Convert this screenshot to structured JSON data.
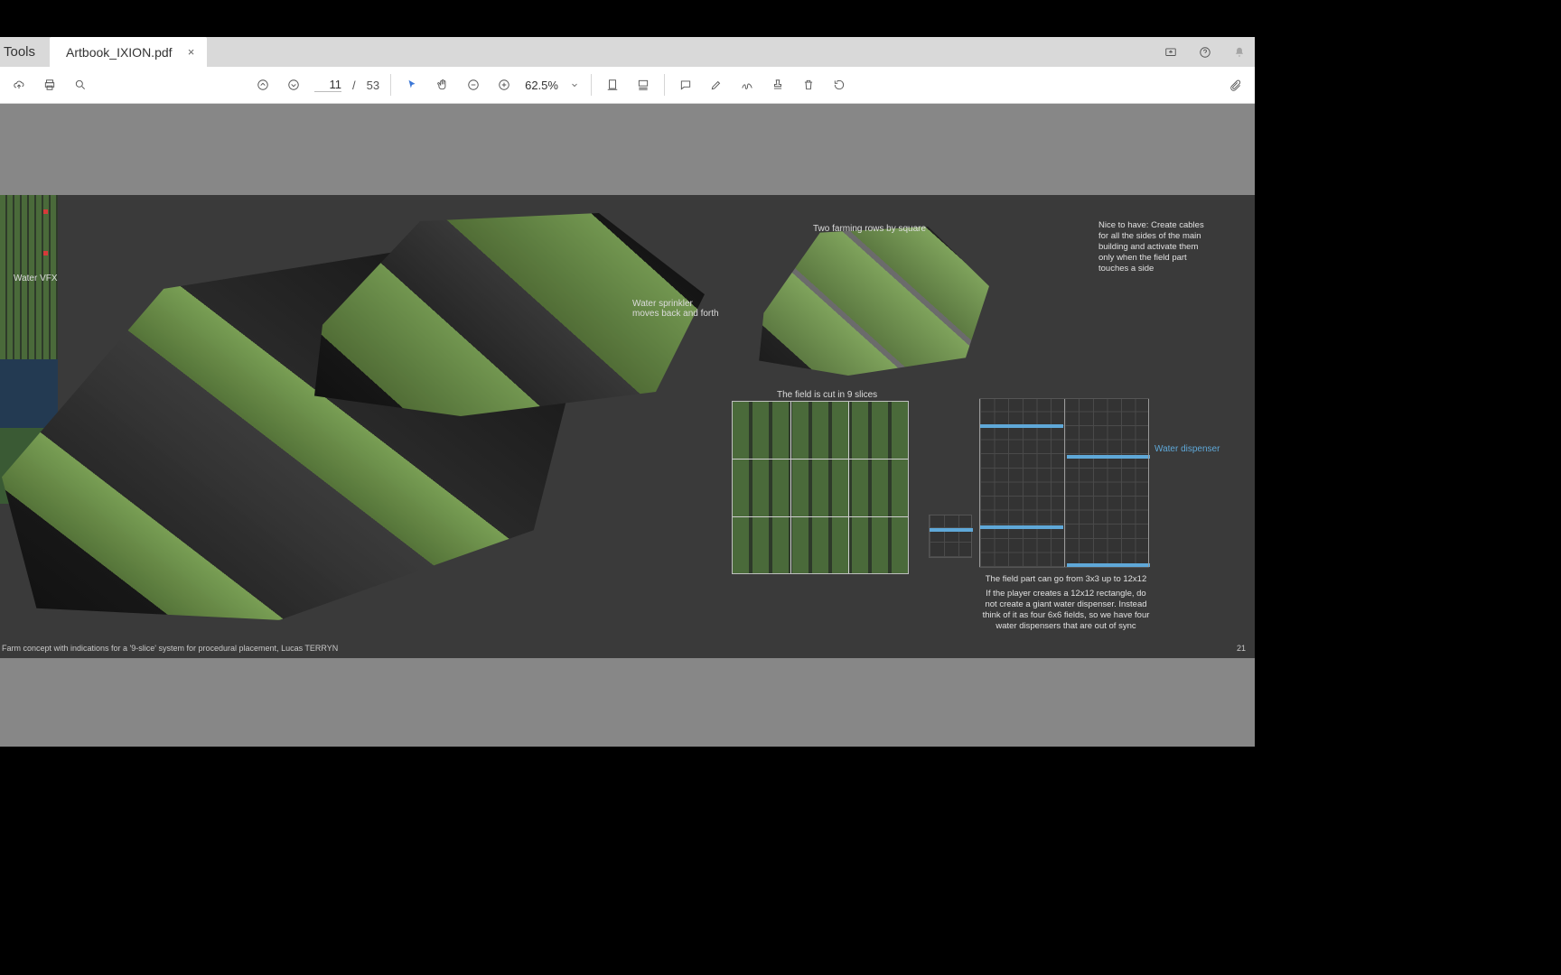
{
  "tabs": {
    "tools": "Tools",
    "doc": "Artbook_IXION.pdf"
  },
  "nav": {
    "page": "11",
    "sep": "/",
    "total": "53"
  },
  "zoom": {
    "value": "62.5%"
  },
  "content": {
    "water_vfx": "Water VFX",
    "sprinkler": "Water sprinkler\nmoves back and forth",
    "two_rows": "Two farming rows by square",
    "cables": "Nice to have: Create cables for all the sides of the main building and activate them only when the field part touches a side",
    "nine_slices": "The field is cut in 9 slices",
    "dispenser": "Water dispenser",
    "range": "The field part can go from 3x3 up to 12x12",
    "rectangle": "If the player creates a 12x12 rectangle, do not create a giant water dispenser. Instead think of it as four 6x6 fields, so we have four water dispensers that are out of sync",
    "caption": "Farm concept with indications for a '9-slice' system for procedural placement, Lucas TERRYN",
    "page_number": "21"
  }
}
